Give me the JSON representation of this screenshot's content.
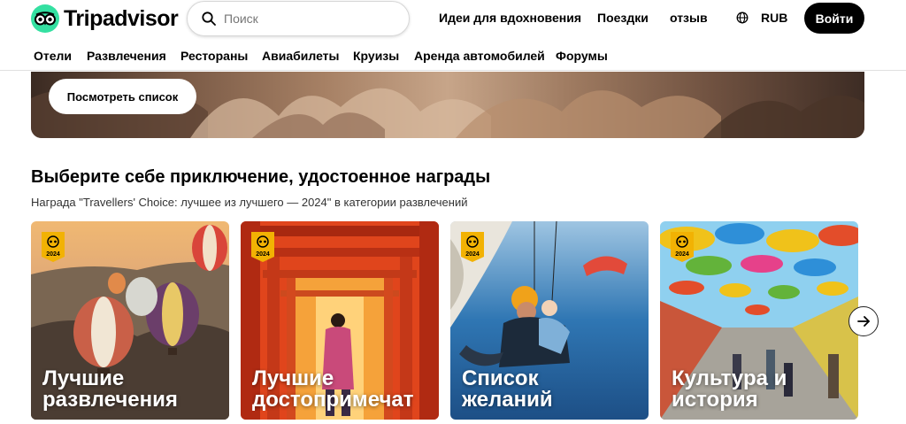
{
  "header": {
    "logo_text": "Tripadvisor",
    "search_placeholder": "Поиск",
    "nav": [
      "Идеи для вдохновения",
      "Поездки",
      "отзыв"
    ],
    "currency": "RUB",
    "login_label": "Войти"
  },
  "categories": [
    "Отели",
    "Развлечения",
    "Рестораны",
    "Авиабилеты",
    "Круизы",
    "Аренда автомобилей",
    "Форумы"
  ],
  "hero": {
    "button_label": "Посмотреть список"
  },
  "section": {
    "title": "Выберите себе приключение, удостоенное награды",
    "subtitle": "Награда \"Travellers' Choice: лучшее из лучшего — 2024\" в категории развлечений"
  },
  "cards": [
    {
      "title": "Лучшие\nразвлечения",
      "badge_year": "2024"
    },
    {
      "title": "Лучшие\nдостопримечат",
      "badge_year": "2024"
    },
    {
      "title": "Список\nжеланий",
      "badge_year": "2024"
    },
    {
      "title": "Культура и\nистория",
      "badge_year": "2024"
    }
  ],
  "colors": {
    "brand": "#34e0a1",
    "badge": "#f2b203",
    "button_dark": "#000000"
  },
  "icons": [
    "owl-logo-icon",
    "search-icon",
    "globe-icon",
    "award-badge-icon",
    "arrow-right-icon"
  ]
}
